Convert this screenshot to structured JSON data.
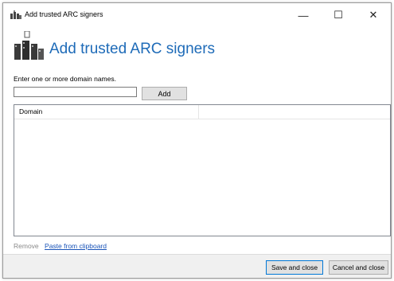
{
  "window": {
    "title": "Add trusted ARC signers",
    "minimize_glyph": "—",
    "maximize_glyph": "☐",
    "close_glyph": "✕"
  },
  "header": {
    "title": "Add trusted ARC signers",
    "icon": "servers-icon"
  },
  "form": {
    "instruction": "Enter one or more domain names.",
    "domain_value": "",
    "domain_placeholder": "",
    "add_label": "Add"
  },
  "list": {
    "columns": [
      "Domain",
      ""
    ],
    "rows": []
  },
  "links": {
    "remove_label": "Remove",
    "paste_label": "Paste from clipboard"
  },
  "buttons": {
    "save_label": "Save and close",
    "cancel_label": "Cancel and close"
  },
  "colors": {
    "header_title": "#1e6bb8",
    "link": "#1a54b8",
    "disabled_link": "#8a8a8a",
    "default_button_border": "#0078d7"
  }
}
